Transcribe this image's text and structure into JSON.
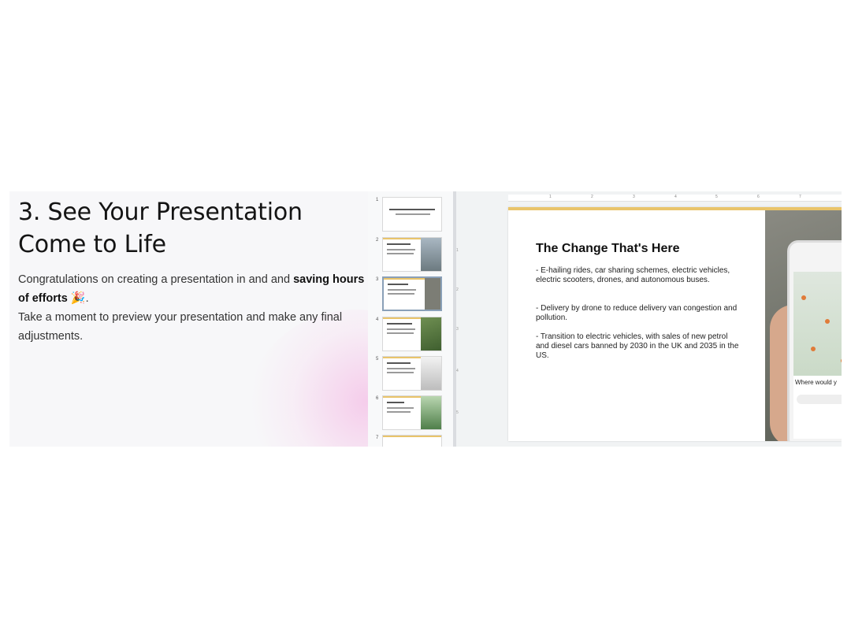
{
  "section": {
    "heading_line1": "3. See Your Presentation",
    "heading_line2": "Come to Life",
    "para1_start": "Congratulations on creating a presentation in and and ",
    "para1_bold": "saving hours of efforts",
    "para1_emoji": "🎉",
    "para1_end": ".",
    "para2": "Take a moment to preview your presentation and make any final adjustments."
  },
  "editor": {
    "thumbnail_numbers": [
      "1",
      "2",
      "3",
      "4",
      "5",
      "6",
      "7"
    ],
    "selected_slide": 3,
    "ruler_numbers": [
      "1",
      "2",
      "3",
      "4",
      "5",
      "6",
      "7"
    ],
    "vertical_ruler_numbers": [
      "1",
      "2",
      "3",
      "4",
      "5"
    ],
    "slide": {
      "title": "The Change That's Here",
      "bullets": [
        "-  E-hailing rides, car sharing schemes, electric vehicles, electric scooters, drones, and autonomous buses.",
        "-  Delivery by drone to reduce delivery van congestion and pollution.",
        "-  Transition to electric vehicles, with sales of new petrol and diesel cars banned by 2030 in the UK and 2035 in the US."
      ],
      "image_caption": "Where would y"
    }
  },
  "colors": {
    "accent_yellow": "#e9c46a",
    "glow_pink": "#f4bee6"
  }
}
